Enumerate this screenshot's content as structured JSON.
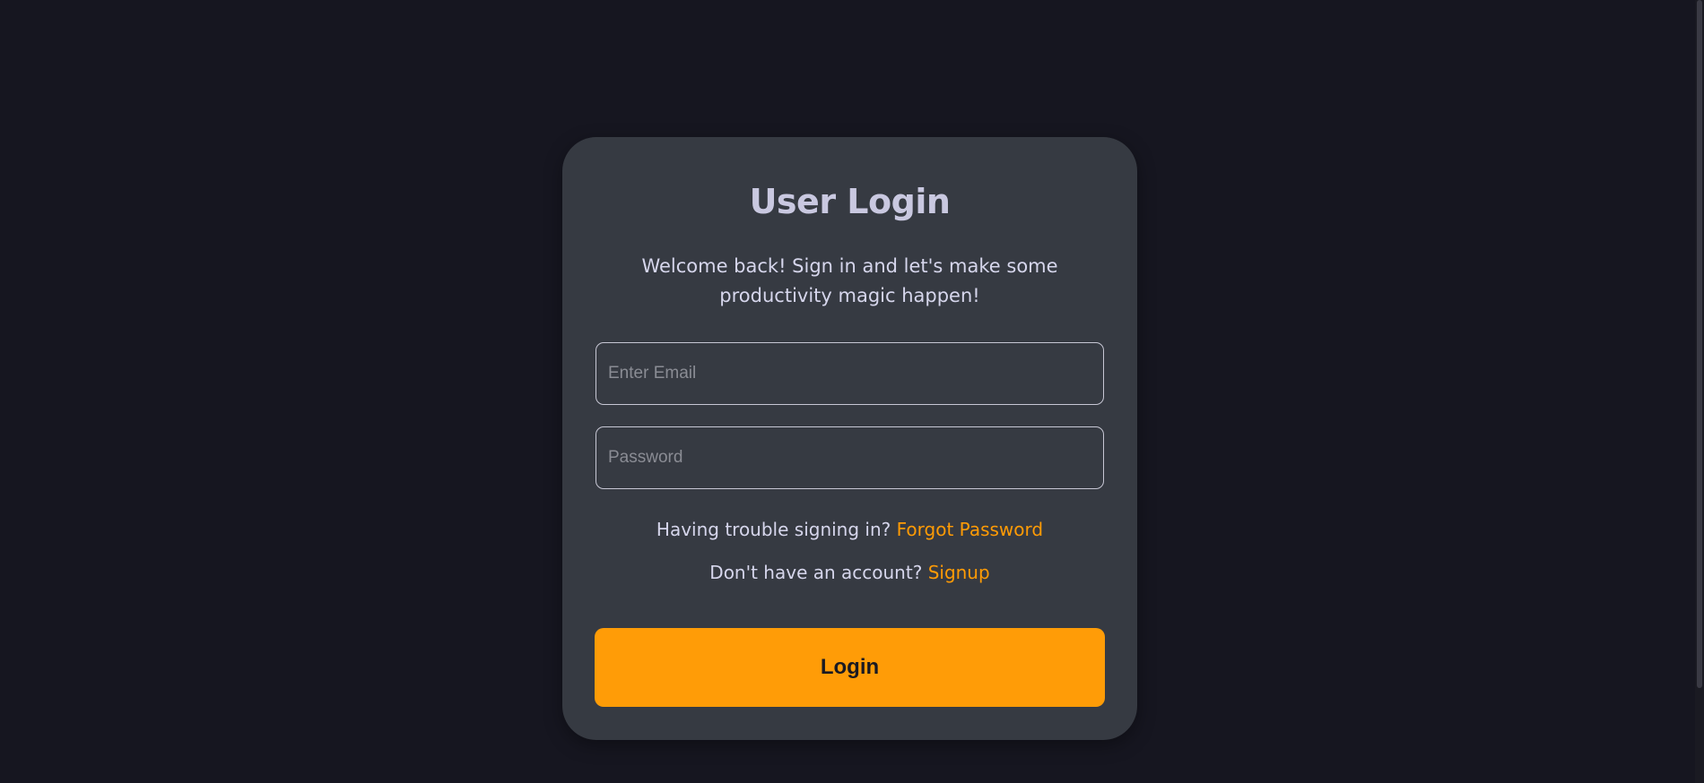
{
  "login": {
    "title": "User Login",
    "subtitle": "Welcome back! Sign in and let's make some productivity magic happen!",
    "email_placeholder": "Enter Email",
    "email_value": "",
    "password_placeholder": "Password",
    "password_value": "",
    "trouble_text": "Having trouble signing in?",
    "forgot_link": "Forgot Password",
    "no_account_text": "Don't have an account?",
    "signup_link": "Signup",
    "login_button": "Login"
  },
  "colors": {
    "background": "#161620",
    "card": "#363a42",
    "accent": "#ff9c07",
    "heading": "#c9c8e0"
  }
}
